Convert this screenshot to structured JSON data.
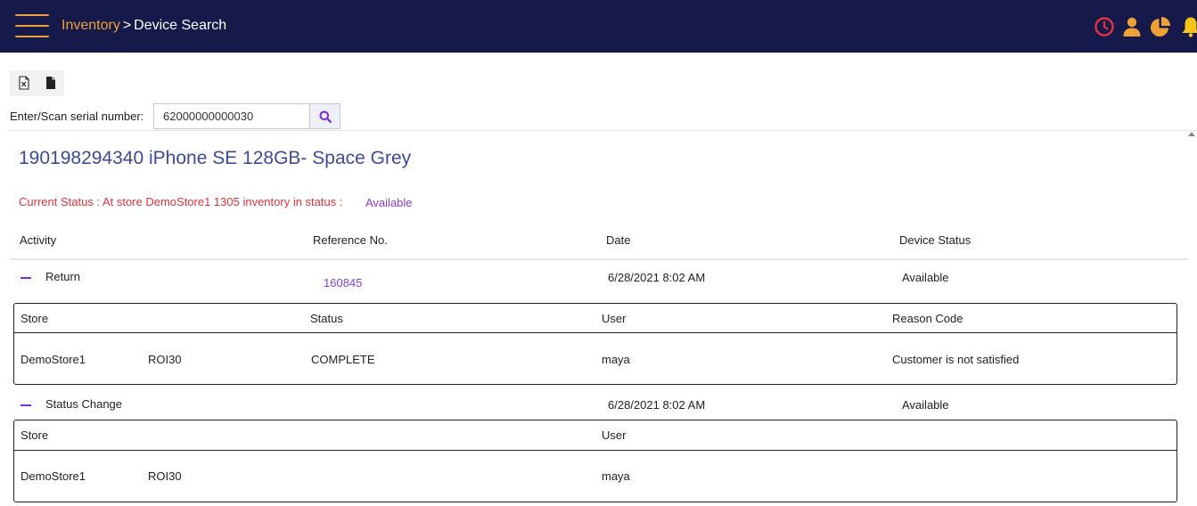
{
  "header": {
    "breadcrumb_root": "Inventory",
    "breadcrumb_sep": ">",
    "breadcrumb_current": "Device Search",
    "icons": [
      "clock-icon",
      "user-icon",
      "pie-chart-icon",
      "bell-icon"
    ]
  },
  "colors": {
    "topbar": "#151a4a",
    "accent": "#f0a136",
    "alert": "#e0333e",
    "link": "#8a3fd6",
    "title": "#3d4a96"
  },
  "toolbar": {
    "icons": [
      "excel-export-icon",
      "document-export-icon"
    ]
  },
  "search": {
    "label": "Enter/Scan serial number:",
    "value": "62000000000030"
  },
  "device": {
    "title": "190198294340 iPhone SE 128GB- Space Grey",
    "status_text": "Current Status : At store DemoStore1 1305 inventory in status :",
    "status_value": "Available"
  },
  "history": {
    "columns": [
      "Activity",
      "Reference No.",
      "Date",
      "Device Status"
    ],
    "entries": [
      {
        "activity": "Return",
        "reference": "160845",
        "date": "6/28/2021 8:02 AM",
        "device_status": "Available",
        "detail_columns": [
          "Store",
          "Status",
          "User",
          "Reason Code"
        ],
        "detail_row": {
          "store": "DemoStore1",
          "store_code": "ROI30",
          "status": "COMPLETE",
          "user": "maya",
          "reason": "Customer is not satisfied"
        }
      },
      {
        "activity": "Status Change",
        "reference": "",
        "date": "6/28/2021 8:02 AM",
        "device_status": "Available",
        "detail_columns": [
          "Store",
          "User"
        ],
        "detail_row": {
          "store": "DemoStore1",
          "store_code": "ROI30",
          "user": "maya"
        }
      }
    ]
  }
}
